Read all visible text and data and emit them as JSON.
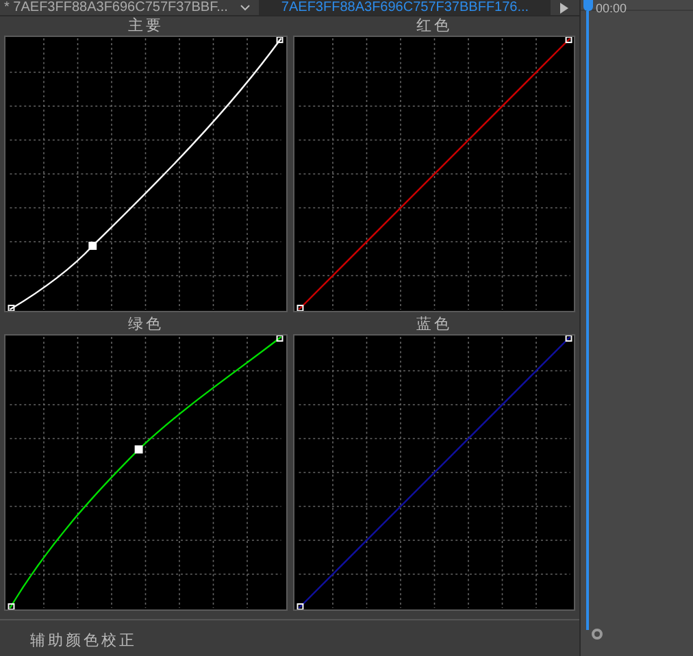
{
  "tabs": [
    {
      "label": "* 7AEF3FF88A3F696C757F37BBF...",
      "selected": false
    },
    {
      "label": "7AEF3FF88A3F696C757F37BBFF176...",
      "selected": true
    }
  ],
  "timecode": "00:00",
  "curves": [
    {
      "title": "主要",
      "color": "#ffffff",
      "point": true
    },
    {
      "title": "红色",
      "color": "#d00000",
      "point": false
    },
    {
      "title": "绿色",
      "color": "#00e000",
      "point": true
    },
    {
      "title": "蓝色",
      "color": "#1010a0",
      "point": false
    }
  ],
  "section": {
    "title": "辅助颜色校正"
  }
}
